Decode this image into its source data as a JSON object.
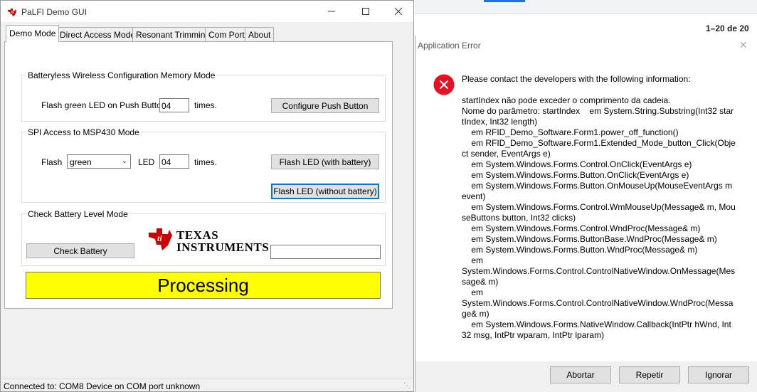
{
  "background": {
    "pager": "1–20 de 20"
  },
  "main_window": {
    "title": "PaLFI Demo GUI",
    "tabs": [
      {
        "label": "Demo Mode"
      },
      {
        "label": "Direct Access Mode"
      },
      {
        "label": "Resonant Trimming"
      },
      {
        "label": "Com Port"
      },
      {
        "label": "About"
      }
    ],
    "group1": {
      "title": "Batteryless Wireless  Configuration Memory Mode",
      "flash_label": "Flash green LED on Push Button",
      "count_value": "04",
      "times_label": "times.",
      "configure_button": "Configure Push Button"
    },
    "group2": {
      "title": "SPI Access to MSP430 Mode",
      "flash_label": "Flash",
      "color_value": "green",
      "led_label": "LED",
      "count_value": "04",
      "times_label": "times.",
      "flash_with_battery_button": "Flash LED (with battery)",
      "flash_without_battery_button": "Flash LED (without battery)"
    },
    "group3": {
      "title": "Check Battery Level Mode",
      "check_battery_button": "Check Battery",
      "battery_value": "",
      "brand_line1": "TEXAS",
      "brand_line2": "INSTRUMENTS"
    },
    "processing_text": "Processing",
    "status_text": "Connected to: COM8  Device on COM port unknown",
    "colors": {
      "processing_bg": "#ffff00",
      "ti_red": "#cc0000",
      "focus_blue": "#0078d7"
    }
  },
  "error_dialog": {
    "title": "Application Error",
    "heading": "Please contact the developers with the following information:",
    "details": "startIndex não pode exceder o comprimento da cadeia.\nNome do parâmetro: startIndex    em System.String.Substring(Int32 startIndex, Int32 length)\n    em RFID_Demo_Software.Form1.power_off_function()\n    em RFID_Demo_Software.Form1.Extended_Mode_button_Click(Object sender, EventArgs e)\n    em System.Windows.Forms.Control.OnClick(EventArgs e)\n    em System.Windows.Forms.Button.OnClick(EventArgs e)\n    em System.Windows.Forms.Button.OnMouseUp(MouseEventArgs mevent)\n    em System.Windows.Forms.Control.WmMouseUp(Message& m, MouseButtons button, Int32 clicks)\n    em System.Windows.Forms.Control.WndProc(Message& m)\n    em System.Windows.Forms.ButtonBase.WndProc(Message& m)\n    em System.Windows.Forms.Button.WndProc(Message& m)\n    em\nSystem.Windows.Forms.Control.ControlNativeWindow.OnMessage(Message& m)\n    em\nSystem.Windows.Forms.Control.ControlNativeWindow.WndProc(Message& m)\n    em System.Windows.Forms.NativeWindow.Callback(IntPtr hWnd, Int32 msg, IntPtr wparam, IntPtr lparam)",
    "buttons": {
      "abort": "Abortar",
      "retry": "Repetir",
      "ignore": "Ignorar"
    },
    "icon": "error-icon",
    "icon_color": "#e81123"
  }
}
